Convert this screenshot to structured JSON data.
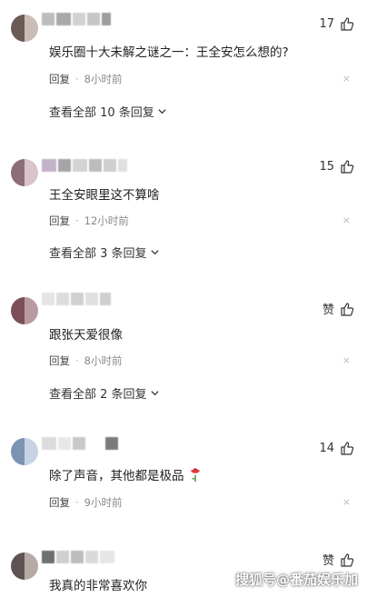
{
  "ui": {
    "reply_label": "回复",
    "close_glyph": "×",
    "separator": "·"
  },
  "comments": [
    {
      "name": "视频简报",
      "text": "娱乐圈十大未解之谜之一：王全安怎么想的?",
      "time": "8小时前",
      "likes": "17",
      "more": "查看全部 10 条回复"
    },
    {
      "text": "王全安眼里这不算啥",
      "time": "12小时前",
      "likes": "15",
      "more": "查看全部 3 条回复"
    },
    {
      "text": "跟张天爱很像",
      "time": "8小时前",
      "likes": "赞",
      "more": "查看全部 2 条回复"
    },
    {
      "text": "除了声音，其他都是极品",
      "time": "9小时前",
      "likes": "14"
    },
    {
      "text": "我真的非常喜欢你",
      "time": "",
      "likes": "赞"
    }
  ],
  "watermark": "搜狐号@番茄娱乐加",
  "icons": {
    "like": "thumbs-up-icon",
    "chevron": "chevron-down-icon",
    "close": "close-icon",
    "rose": "rose-icon"
  },
  "colors": {
    "text": "#222222",
    "meta": "#888888",
    "background": "#ffffff"
  }
}
